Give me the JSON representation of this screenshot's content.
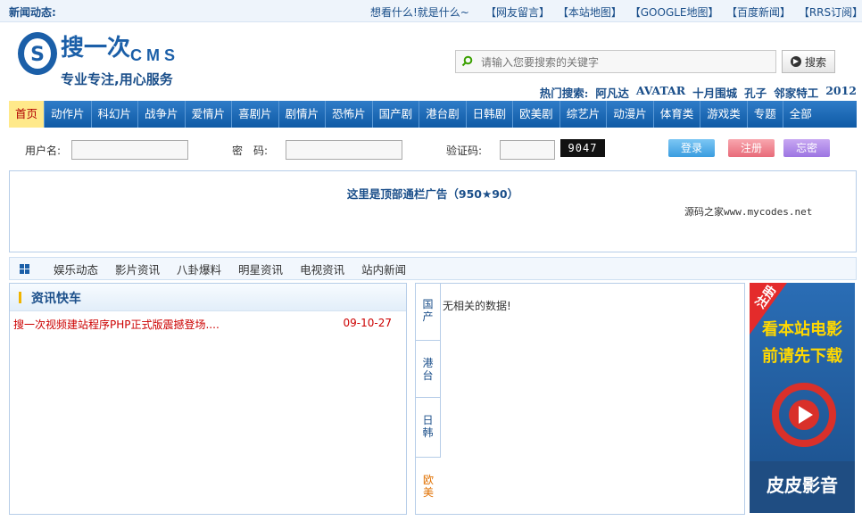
{
  "topbar": {
    "news_label": "新闻动态:",
    "slogan": "想看什么!就是什么~",
    "links": [
      "【网友留言】",
      "【本站地图】",
      "【GOOGLE地图】",
      "【百度新闻】",
      "【RRS订阅】"
    ]
  },
  "logo": {
    "mark": "搜一次",
    "cms": "C M S",
    "tagline": "专业专注,用心服务"
  },
  "search": {
    "placeholder": "请输入您要搜索的关键字",
    "button": "搜索",
    "hot_label": "热门搜索:",
    "hot_terms": [
      "阿凡达",
      "AVATAR",
      "十月围城",
      "孔子",
      "邻家特工",
      "2012"
    ]
  },
  "nav": {
    "items": [
      "首页",
      "动作片",
      "科幻片",
      "战争片",
      "爱情片",
      "喜剧片",
      "剧情片",
      "恐怖片",
      "国产剧",
      "港台剧",
      "日韩剧",
      "欧美剧",
      "综艺片",
      "动漫片",
      "体育类",
      "游戏类",
      "专题",
      "全部"
    ],
    "active": "首页"
  },
  "login": {
    "username_label": "用户名:",
    "password_label": "密　码:",
    "captcha_label": "验证码:",
    "captcha_text": "9047",
    "login_button": "登录",
    "register_button": "注册",
    "forgot_button": "忘密"
  },
  "ad": {
    "title": "这里是顶部通栏广告（950★90）",
    "credit": "源码之家www.mycodes.net"
  },
  "subnav": {
    "items": [
      "娱乐动态",
      "影片资讯",
      "八卦爆料",
      "明星资讯",
      "电视资讯",
      "站内新闻"
    ]
  },
  "news_panel": {
    "title": "资讯快车",
    "items": [
      {
        "title": "搜一次视频建站程序PHP正式版震撼登场....",
        "date": "09-10-27"
      }
    ]
  },
  "tabs_panel": {
    "tabs": [
      "国产",
      "港台",
      "日韩",
      "欧美"
    ],
    "active_tab": "欧美",
    "empty_text": "无相关的数据!"
  },
  "side_ad": {
    "badge": "注册",
    "line1": "看本站电影",
    "line2": "前请先下载",
    "brand": "皮皮影音"
  },
  "colors": {
    "brand_blue": "#1b4f8a",
    "nav_blue": "#1a66b3",
    "news_red": "#cc0000",
    "active_tab": "#e07000"
  }
}
